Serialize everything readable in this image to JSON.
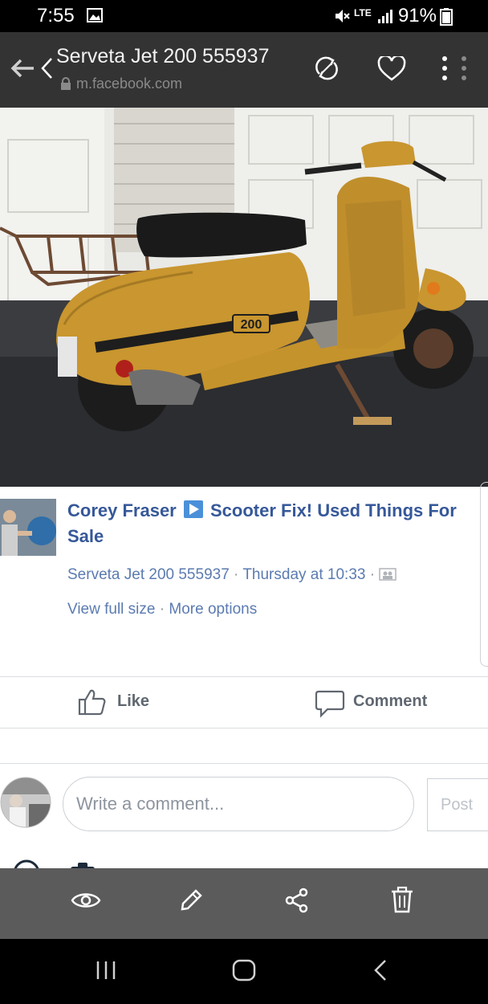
{
  "status_bar": {
    "time": "7:55",
    "battery": "91%",
    "network": "LTE"
  },
  "top_bar": {
    "title": "Serveta Jet 200 555937",
    "url": "m.facebook.com"
  },
  "photo": {
    "badge_text": "200"
  },
  "post": {
    "author": "Corey Fraser",
    "group": "Scooter Fix! Used Things For Sale",
    "caption": "Serveta Jet 200 555937",
    "time": "Thursday at 10:33",
    "view_full_size": "View full size",
    "more_options": "More options"
  },
  "actions": {
    "like": "Like",
    "comment": "Comment"
  },
  "comment_box": {
    "placeholder": "Write a comment...",
    "post": "Post"
  },
  "colors": {
    "link": "#365899",
    "toolbar": "#5b5b5b",
    "topbar": "#333333"
  }
}
